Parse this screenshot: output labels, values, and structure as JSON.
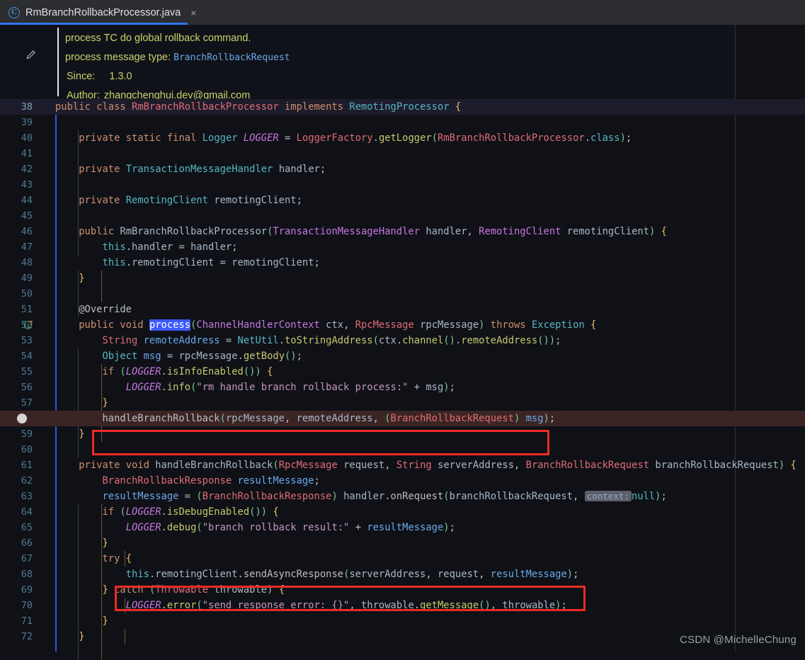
{
  "tab": {
    "icon": "java-class-icon",
    "title": "RmBranchRollbackProcessor.java",
    "close_label": "×"
  },
  "javadoc": {
    "gutter_icon": "pencil-edit-icon",
    "line1": "process TC do global rollback command.",
    "line2_label": "process message type: ",
    "line2_type": "BranchRollbackRequest",
    "since_label": "Since:",
    "since_value": "1.3.0",
    "author_label": "Author:",
    "author_value": "zhangchenghui.dev@gmail.com"
  },
  "gutter_icons": {
    "implementing_method": "implementing-method-icon",
    "breakpoint": "breakpoint-icon"
  },
  "lines": [
    {
      "n": "38"
    },
    {
      "n": "39"
    },
    {
      "n": "40"
    },
    {
      "n": "41"
    },
    {
      "n": "42"
    },
    {
      "n": "43"
    },
    {
      "n": "44"
    },
    {
      "n": "45"
    },
    {
      "n": "46"
    },
    {
      "n": "47"
    },
    {
      "n": "48"
    },
    {
      "n": "49"
    },
    {
      "n": "50"
    },
    {
      "n": "51"
    },
    {
      "n": "52"
    },
    {
      "n": "53"
    },
    {
      "n": "54"
    },
    {
      "n": "55"
    },
    {
      "n": "56"
    },
    {
      "n": "57"
    },
    {
      "n": ""
    },
    {
      "n": "59"
    },
    {
      "n": "60"
    },
    {
      "n": "61"
    },
    {
      "n": "62"
    },
    {
      "n": "63"
    },
    {
      "n": "64"
    },
    {
      "n": "65"
    },
    {
      "n": "66"
    },
    {
      "n": "67"
    },
    {
      "n": "68"
    },
    {
      "n": "69"
    },
    {
      "n": "70"
    },
    {
      "n": "71"
    },
    {
      "n": "72"
    }
  ],
  "code": {
    "l38": "public class RmBranchRollbackProcessor implements RemotingProcessor {",
    "l39": "",
    "l40": "    private static final Logger LOGGER = LoggerFactory.getLogger(RmBranchRollbackProcessor.class);",
    "l41": "",
    "l42": "    private TransactionMessageHandler handler;",
    "l43": "",
    "l44": "    private RemotingClient remotingClient;",
    "l45": "",
    "l46": "    public RmBranchRollbackProcessor(TransactionMessageHandler handler, RemotingClient remotingClient) {",
    "l47": "        this.handler = handler;",
    "l48": "        this.remotingClient = remotingClient;",
    "l49": "    }",
    "l50": "",
    "l51": "    @Override",
    "l52": "    public void process(ChannelHandlerContext ctx, RpcMessage rpcMessage) throws Exception {",
    "l53": "        String remoteAddress = NetUtil.toStringAddress(ctx.channel().remoteAddress());",
    "l54": "        Object msg = rpcMessage.getBody();",
    "l55": "        if (LOGGER.isInfoEnabled()) {",
    "l56": "            LOGGER.info(\"rm handle branch rollback process:\" + msg);",
    "l57": "        }",
    "l58": "        handleBranchRollback(rpcMessage, remoteAddress, (BranchRollbackRequest) msg);",
    "l59": "    }",
    "l60": "",
    "l61": "    private void handleBranchRollback(RpcMessage request, String serverAddress, BranchRollbackRequest branchRollbackRequest) {",
    "l62": "        BranchRollbackResponse resultMessage;",
    "l63": "        resultMessage = (BranchRollbackResponse) handler.onRequest(branchRollbackRequest, null);",
    "l64": "        if (LOGGER.isDebugEnabled()) {",
    "l65": "            LOGGER.debug(\"branch rollback result:\" + resultMessage);",
    "l66": "        }",
    "l67": "        try {",
    "l68": "            this.remotingClient.sendAsyncResponse(serverAddress, request, resultMessage);",
    "l69": "        } catch (Throwable throwable) {",
    "l70": "            LOGGER.error(\"send response error: {}\", throwable.getMessage(), throwable);",
    "l71": "        }",
    "l72": "    }"
  },
  "inlay_hints": {
    "context": "context:"
  },
  "highlighted_symbol": "process",
  "annotations": {
    "box1_target": "handleBranchRollback-call",
    "box2_target": "sendAsyncResponse-call",
    "box_color": "#ee2a24"
  },
  "watermark": "CSDN @MichelleChung",
  "colors": {
    "background": "#0f1117",
    "tab_bar": "#2b2d30",
    "tab_active_underline": "#3574f0",
    "current_line": "#1d1c2b",
    "highlight_line": "#3b2524",
    "caret_bar": "#3355dd"
  }
}
